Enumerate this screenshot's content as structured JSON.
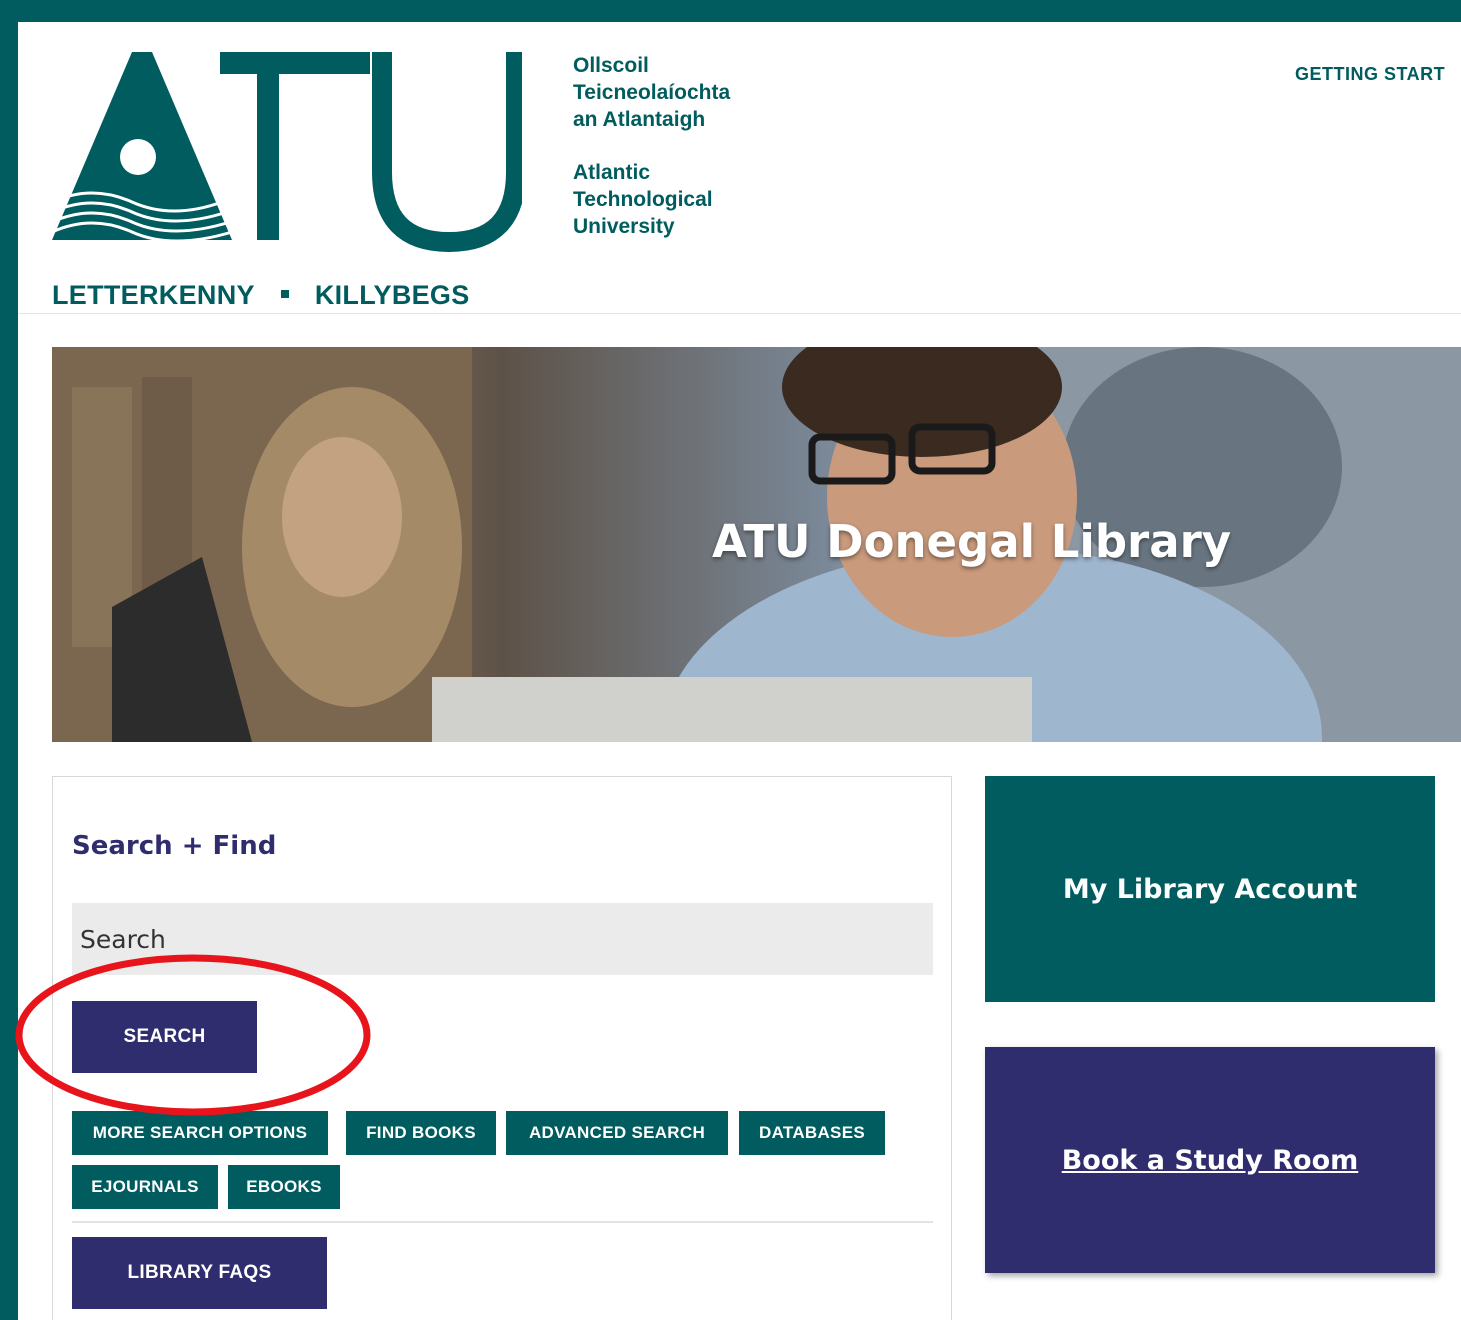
{
  "header": {
    "logo_text": "ATU",
    "irish_name": [
      "Ollscoil",
      "Teicneolaíochta",
      "an Atlantaigh"
    ],
    "english_name": [
      "Atlantic",
      "Technological",
      "University"
    ],
    "nav_item": "GETTING START",
    "campuses": [
      "LETTERKENNY",
      "KILLYBEGS"
    ]
  },
  "hero": {
    "title": "ATU Donegal Library"
  },
  "search": {
    "title": "Search + Find",
    "placeholder": "Search",
    "button_label": "SEARCH",
    "quick_links": [
      "MORE SEARCH OPTIONS",
      "FIND BOOKS",
      "ADVANCED SEARCH",
      "DATABASES",
      "EJOURNALS",
      "EBOOKS"
    ],
    "faq_label": "LIBRARY FAQS"
  },
  "tiles": {
    "account": "My Library Account",
    "study_room": "Book a Study Room"
  },
  "colors": {
    "brand_teal": "#005c5e",
    "brand_purple": "#2f2d6e",
    "annotation_red": "#e8141b"
  }
}
